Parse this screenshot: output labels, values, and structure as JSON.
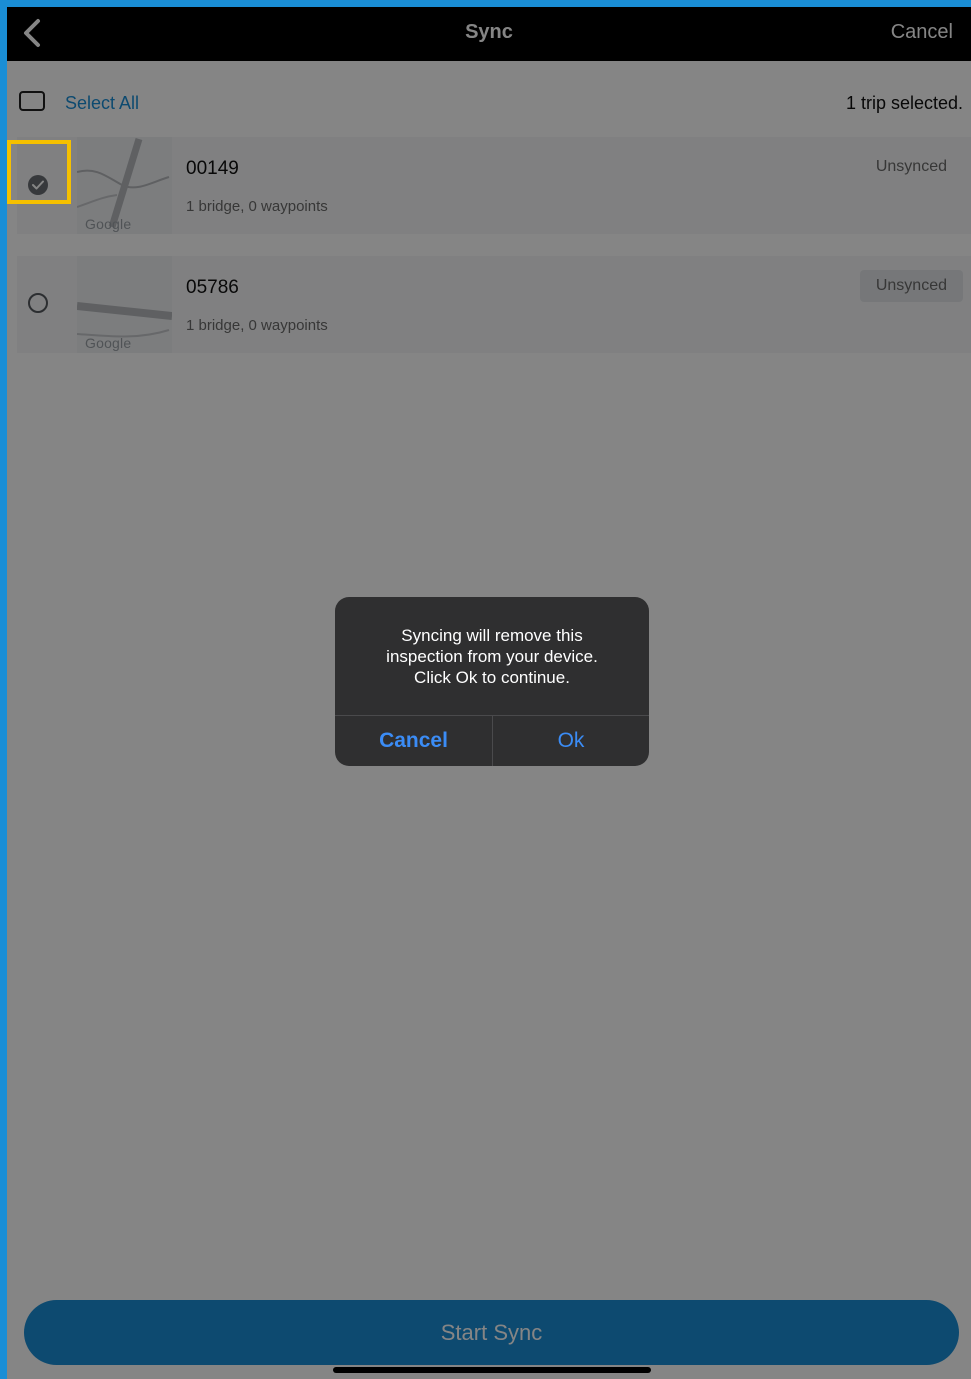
{
  "navbar": {
    "title": "Sync",
    "cancel_label": "Cancel",
    "back_icon": "chevron-left-icon"
  },
  "selection": {
    "select_all_label": "Select All",
    "count_text": "1 trip selected."
  },
  "trips": [
    {
      "id": "00149",
      "summary": "1 bridge, 0 waypoints",
      "status": "Unsynced",
      "selected": true,
      "map_logo": "Google"
    },
    {
      "id": "05786",
      "summary": "1 bridge, 0 waypoints",
      "status": "Unsynced",
      "selected": false,
      "map_logo": "Google"
    }
  ],
  "primary_action": {
    "label": "Start Sync"
  },
  "alert": {
    "message_line1": "Syncing will remove this",
    "message_line2": "inspection from your device.",
    "message_line3": "Click Ok to continue.",
    "cancel_label": "Cancel",
    "ok_label": "Ok"
  },
  "colors": {
    "accent": "#1a8ed6",
    "navbar": "#000000",
    "alert_bg": "#2f2f30",
    "alert_button": "#3b8cf5",
    "highlight": "#f5c000"
  }
}
